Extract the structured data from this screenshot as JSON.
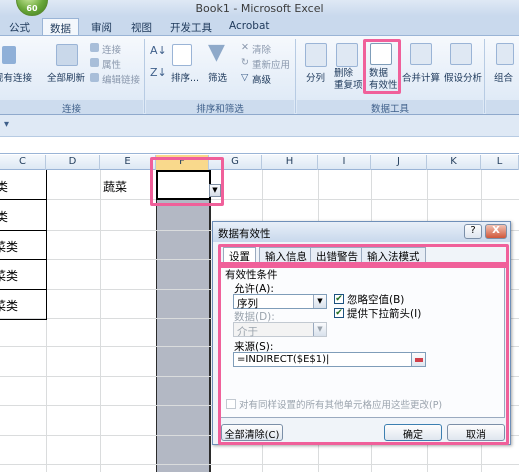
{
  "window": {
    "title": "Book1 - Microsoft Excel"
  },
  "office_button": {
    "label": "60"
  },
  "tabs": [
    "公式",
    "数据",
    "审阅",
    "视图",
    "开发工具",
    "Acrobat"
  ],
  "ribbon": {
    "groups": {
      "connections": {
        "label": "连接",
        "existing_connections": "现有连接",
        "refresh_all": "全部刷新",
        "connections": "连接",
        "properties": "属性",
        "edit_links": "编辑链接"
      },
      "sort_filter": {
        "label": "排序和筛选",
        "sort": "排序...",
        "filter": "筛选",
        "clear": "清除",
        "reapply": "重新应用",
        "advanced": "高级"
      },
      "data_tools": {
        "label": "数据工具",
        "text_to_columns": "分列",
        "remove_duplicates": "删除\n重复项",
        "data_validation": "数据\n有效性",
        "consolidate": "合并计算",
        "what_if": "假设分析"
      },
      "outline": {
        "group": "组合"
      }
    }
  },
  "sheet": {
    "columns": [
      "C",
      "D",
      "E",
      "F",
      "G",
      "H",
      "I",
      "J",
      "K",
      "L"
    ],
    "selected_column": "F",
    "cells": {
      "c_row1": "类",
      "c_row2": "类",
      "c_row3": "菜类",
      "c_row4": "菜类",
      "c_row5": "菜类",
      "e_row1": "蔬菜"
    }
  },
  "dialog": {
    "title": "数据有效性",
    "help_button": "?",
    "close_button": "X",
    "tabs": [
      "设置",
      "输入信息",
      "出错警告",
      "输入法模式"
    ],
    "validation_criteria": "有效性条件",
    "allow_label": "允许(A):",
    "allow_value": "序列",
    "ignore_blank": "忽略空值(B)",
    "in_cell_dropdown": "提供下拉箭头(I)",
    "data_label": "数据(D):",
    "data_value": "介于",
    "source_label": "来源(S):",
    "source_value": "=INDIRECT($E$1)|",
    "apply_all": "对有同样设置的所有其他单元格应用这些更改(P)",
    "clear_all": "全部清除(C)",
    "ok": "确定",
    "cancel": "取消"
  }
}
